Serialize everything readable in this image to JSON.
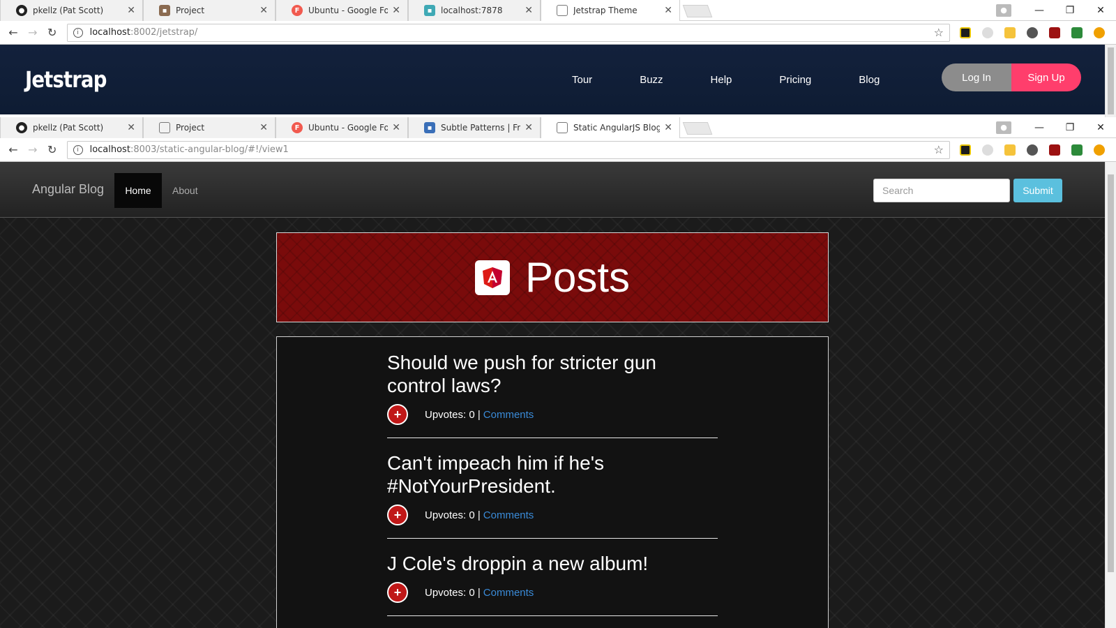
{
  "window1": {
    "tabs": [
      {
        "title": "pkellz (Pat Scott)",
        "icon": "github-icon"
      },
      {
        "title": "Project",
        "icon": "project-icon"
      },
      {
        "title": "Ubuntu - Google Fonts",
        "icon": "google-fonts-icon"
      },
      {
        "title": "localhost:7878",
        "icon": "page-icon"
      },
      {
        "title": "Jetstrap Theme",
        "icon": "page-icon",
        "active": true
      }
    ],
    "url": {
      "host": "localhost",
      "path": ":8002/jetstrap/"
    },
    "site": {
      "logo": "Jetstrap",
      "nav": [
        "Tour",
        "Buzz",
        "Help",
        "Pricing",
        "Blog"
      ],
      "login": "Log In",
      "signup": "Sign Up"
    }
  },
  "window2": {
    "tabs": [
      {
        "title": "pkellz (Pat Scott)",
        "icon": "github-icon"
      },
      {
        "title": "Project",
        "icon": "page-icon"
      },
      {
        "title": "Ubuntu - Google Fonts",
        "icon": "google-fonts-icon"
      },
      {
        "title": "Subtle Patterns | Free te",
        "icon": "subtle-patterns-icon"
      },
      {
        "title": "Static AngularJS Blog",
        "icon": "page-icon",
        "active": true
      }
    ],
    "url": {
      "host": "localhost",
      "path": ":8003/static-angular-blog/#!/view1"
    },
    "site": {
      "brand": "Angular Blog",
      "nav_home": "Home",
      "nav_about": "About",
      "search_placeholder": "Search",
      "submit": "Submit",
      "hero_title": "Posts",
      "posts": [
        {
          "title": "Should we push for stricter gun control laws?",
          "upvotes_text": "Upvotes: 0 |",
          "comments": "Comments"
        },
        {
          "title": "Can't impeach him if he's #NotYourPresident.",
          "upvotes_text": "Upvotes: 0 |",
          "comments": "Comments"
        },
        {
          "title": "J Cole's droppin a new album!",
          "upvotes_text": "Upvotes: 0 |",
          "comments": "Comments"
        }
      ]
    }
  },
  "colors": {
    "jetstrap_nav": "#10203a",
    "signup": "#ff3e6c",
    "login": "#8c8c8c",
    "hero_red": "#7a0b0b",
    "submit": "#5bc0de",
    "link": "#3a8bd8",
    "upvote": "#c01818"
  }
}
